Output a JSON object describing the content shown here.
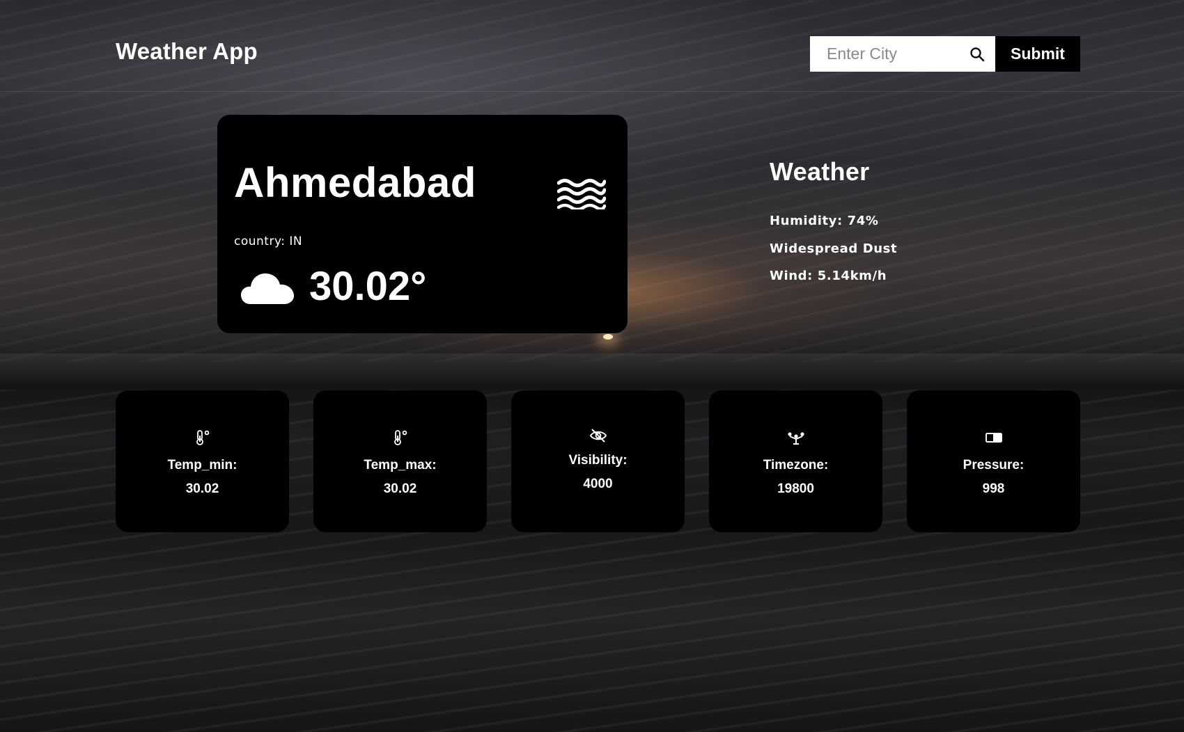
{
  "header": {
    "app_title": "Weather App",
    "search": {
      "placeholder": "Enter City",
      "value": "",
      "icon": "search-icon"
    },
    "submit_label": "Submit"
  },
  "current": {
    "city": "Ahmedabad",
    "condition_icon": "waves-icon",
    "country": "country: IN",
    "weather_icon": "cloud-icon",
    "temperature": "30.02°"
  },
  "details": {
    "heading": "Weather",
    "humidity": "Humidity: 74%",
    "description": "Widespread Dust",
    "wind": "Wind: 5.14km/h"
  },
  "stats": [
    {
      "icon": "thermometer-icon",
      "label": "Temp_min:",
      "value": "30.02"
    },
    {
      "icon": "thermometer-icon",
      "label": "Temp_max:",
      "value": "30.02"
    },
    {
      "icon": "eye-off-icon",
      "label": "Visibility:",
      "value": "4000"
    },
    {
      "icon": "timezone-icon",
      "label": "Timezone:",
      "value": "19800"
    },
    {
      "icon": "pressure-icon",
      "label": "Pressure:",
      "value": "998"
    }
  ]
}
